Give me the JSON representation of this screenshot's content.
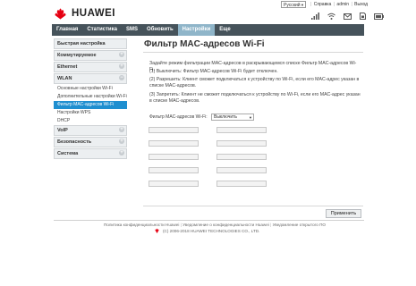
{
  "header": {
    "brand": "HUAWEI",
    "language": "Русский",
    "links": [
      "Справка",
      "admin",
      "Выход"
    ],
    "status_icons": [
      "signal-icon",
      "wifi-icon",
      "mail-icon",
      "sim-icon",
      "battery-icon"
    ]
  },
  "nav": {
    "items": [
      "Главная",
      "Статистика",
      "SMS",
      "Обновить",
      "Настройки",
      "Еще"
    ],
    "active": "Настройки"
  },
  "sidebar": {
    "sections": [
      {
        "label": "Быстрая настройка",
        "has_toggle": false
      },
      {
        "label": "Коммутируемое соединение",
        "has_toggle": true
      },
      {
        "label": "Ethernet",
        "has_toggle": true
      },
      {
        "label": "WLAN",
        "has_toggle": true,
        "items": [
          "Основные настройки Wi-Fi",
          "Дополнительные настройки Wi-Fi",
          "Фильтр MAC-адресов Wi-Fi",
          "Настройки WPS",
          "DHCP"
        ],
        "active_item": "Фильтр MAC-адресов Wi-Fi"
      },
      {
        "label": "VoIP",
        "has_toggle": true
      },
      {
        "label": "Безопасность",
        "has_toggle": true
      },
      {
        "label": "Система",
        "has_toggle": true
      }
    ]
  },
  "main": {
    "title": "Фильтр MAC-адресов Wi-Fi",
    "paragraphs": [
      "Задайте режим фильтрации MAC-адресов в раскрывающемся списке Фильтр MAC-адресов Wi-Fi.",
      "(1) Выключить: Фильтр MAC-адресов Wi-Fi будет отключен.",
      "(2) Разрешить: Клиент сможет подключаться к устройству по Wi-Fi, если его MAC-адрес указан в списке MAC-адресов.",
      "(3) Запретить: Клиент не сможет подключаться к устройству по Wi-Fi, если его MAC-адрес указан в списке MAC-адресов."
    ],
    "filter_label": "Фильтр MAC-адресов Wi-Fi:",
    "filter_value": "Выключить",
    "mac_fields": [
      "",
      "",
      "",
      "",
      "",
      "",
      "",
      "",
      "",
      ""
    ],
    "apply_label": "Применить"
  },
  "footer": {
    "links": [
      "Политика конфиденциальности Huawei",
      "Уведомление о конфиденциальности Huawei",
      "Уведомление открытого ПО"
    ],
    "copyright": "(C) 2006-2018 HUAWEI TECHNOLOGIES CO., LTD."
  },
  "colors": {
    "navbar": "#46535b",
    "nav_active": "#8fb5c9",
    "sidebar_active": "#1f8fd0",
    "brand_red": "#e60012"
  }
}
